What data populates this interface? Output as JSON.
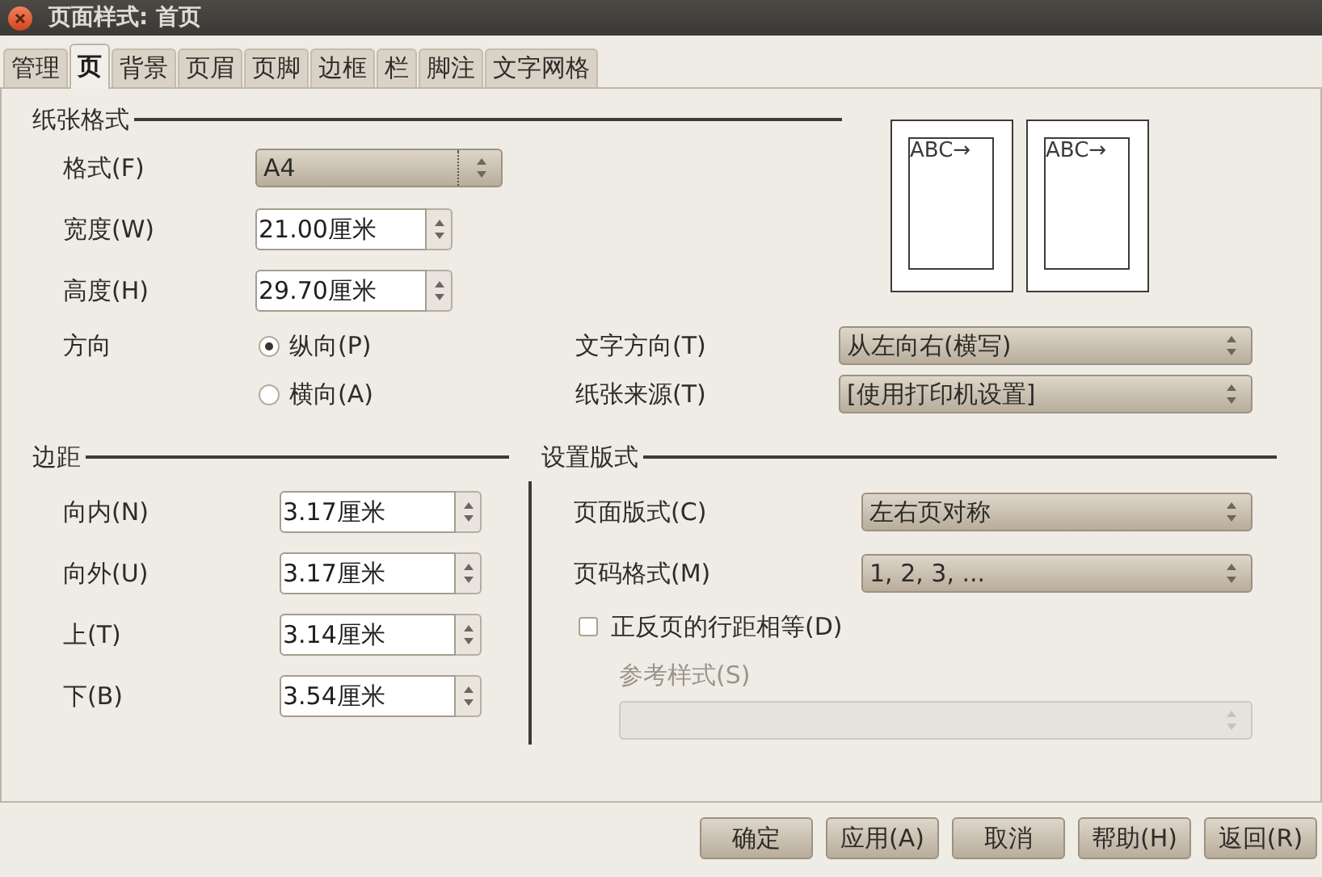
{
  "window": {
    "title": "页面样式: 首页"
  },
  "tabs": [
    {
      "label": "管理",
      "selected": false
    },
    {
      "label": "页",
      "selected": true
    },
    {
      "label": "背景",
      "selected": false
    },
    {
      "label": "页眉",
      "selected": false
    },
    {
      "label": "页脚",
      "selected": false
    },
    {
      "label": "边框",
      "selected": false
    },
    {
      "label": "栏",
      "selected": false
    },
    {
      "label": "脚注",
      "selected": false
    },
    {
      "label": "文字网格",
      "selected": false
    }
  ],
  "paper_format": {
    "heading": "纸张格式",
    "format": {
      "label": "格式(F)",
      "value": "A4"
    },
    "width": {
      "label": "宽度(W)",
      "value": "21.00厘米"
    },
    "height": {
      "label": "高度(H)",
      "value": "29.70厘米"
    },
    "orientation": {
      "label": "方向",
      "options": [
        {
          "label": "纵向(P)",
          "selected": true
        },
        {
          "label": "横向(A)",
          "selected": false
        }
      ]
    },
    "text_direction": {
      "label": "文字方向(T)",
      "value": "从左向右(横写)"
    },
    "paper_tray": {
      "label": "纸张来源(T)",
      "value": "[使用打印机设置]"
    },
    "preview": [
      {
        "text": "ABC→"
      },
      {
        "text": "ABC→"
      }
    ]
  },
  "margins": {
    "heading": "边距",
    "fields": [
      {
        "label": "向内(N)",
        "value": "3.17厘米"
      },
      {
        "label": "向外(U)",
        "value": "3.17厘米"
      },
      {
        "label": "上(T)",
        "value": "3.14厘米"
      },
      {
        "label": "下(B)",
        "value": "3.54厘米"
      }
    ]
  },
  "layout_settings": {
    "heading": "设置版式",
    "page_layout": {
      "label": "页面版式(C)",
      "value": "左右页对称"
    },
    "numbering": {
      "label": "页码格式(M)",
      "value": "1, 2, 3, ..."
    },
    "register_true": {
      "label": "正反页的行距相等(D)",
      "checked": false
    },
    "reference_style": {
      "label": "参考样式(S)",
      "disabled": true
    }
  },
  "buttons": [
    {
      "label": "确定"
    },
    {
      "label": "应用(A)"
    },
    {
      "label": "取消"
    },
    {
      "label": "帮助(H)"
    },
    {
      "label": "返回(R)"
    }
  ]
}
